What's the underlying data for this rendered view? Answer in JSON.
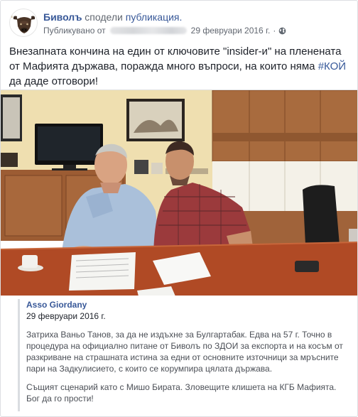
{
  "header": {
    "page_name": "Биволъ",
    "shared_text": "сподели",
    "post_link": "публикация.",
    "published_prefix": "Публикувано от",
    "timestamp": "29 февруари 2016 г.",
    "separator": "·",
    "audience_icon": "globe-icon"
  },
  "post": {
    "text_main": "Внезапната кончина на един от ключовите \"insider-и\" на пленената от Мафията държава, поражда много въпроси, на които няма ",
    "hashtag": "#КОЙ",
    "text_end": " да даде отговори!"
  },
  "quote": {
    "author": "Asso Giordany",
    "date": "29 февруари 2016 г.",
    "paragraph1": "Затриха Ваньо Танов, за да не издъхне за Булгартабак. Едва на 57 г. Точно в процедура на официално питане от Биволъ по ЗДОИ за експорта и на косъм от разкриване на страшната истина за едни от основните източници за мръсните пари на Задкулисието, с които се корумпира цялата държава.",
    "paragraph2": "Същият сценарий като с Мишо Бирата. Зловещите клишета на КГБ Мафията. Бог да го прости!"
  },
  "colors": {
    "link": "#385898",
    "text": "#1d2129",
    "muted": "#616770",
    "quote_border": "#dadde1"
  }
}
